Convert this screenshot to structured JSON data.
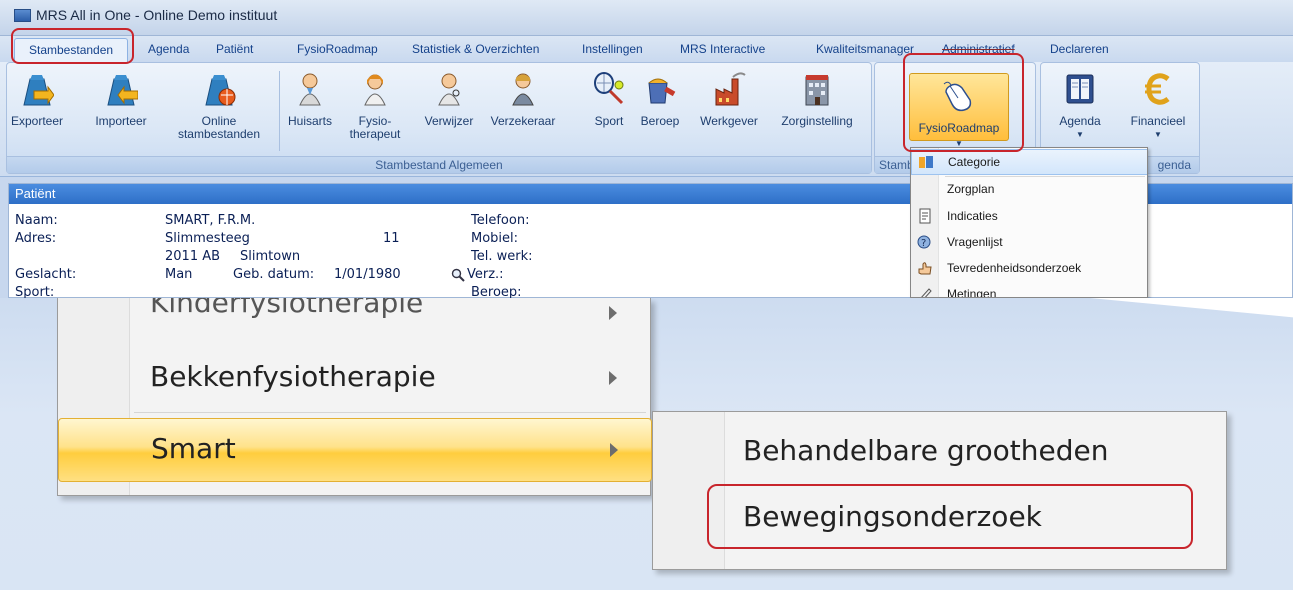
{
  "window": {
    "title": "MRS All in One - Online Demo instituut"
  },
  "tabs": [
    "Stambestanden",
    "Agenda",
    "Patiënt",
    "FysioRoadmap",
    "Statistiek & Overzichten",
    "Instellingen",
    "MRS Interactive",
    "Kwaliteitsmanager",
    "Administratief",
    "Declareren"
  ],
  "ribbon": {
    "buttons": [
      {
        "label": "Exporteer",
        "icon": "bag-arrow-export-icon"
      },
      {
        "label": "Importeer",
        "icon": "bag-arrow-import-icon"
      },
      {
        "label": "Online\nstambestanden",
        "icon": "bag-globe-icon"
      },
      {
        "label": "Huisarts",
        "icon": "doctor-person-icon"
      },
      {
        "label": "Fysio-\ntherapeut",
        "icon": "therapist-person-icon"
      },
      {
        "label": "Verwijzer",
        "icon": "referrer-person-icon"
      },
      {
        "label": "Verzekeraar",
        "icon": "insurer-person-icon"
      },
      {
        "label": "Sport",
        "icon": "racket-ball-icon"
      },
      {
        "label": "Beroep",
        "icon": "paint-bucket-icon"
      },
      {
        "label": "Werkgever",
        "icon": "factory-icon"
      },
      {
        "label": "Zorginstelling",
        "icon": "building-icon"
      }
    ],
    "group_label": "Stambestand Algemeen",
    "group2_label_partial": "Stamb",
    "fysio_button": "FysioRoadmap",
    "agenda_button": "Agenda",
    "financieel_button": "Financieel",
    "group3_label_partial": "genda"
  },
  "patient": {
    "header": "Patiënt",
    "labels": {
      "name": "Naam:",
      "address": "Adres:",
      "gender": "Geslacht:",
      "sport": "Sport:",
      "phone": "Telefoon:",
      "mobile": "Mobiel:",
      "work_phone": "Tel. werk:",
      "insurance": "Verz.:",
      "profession": "Beroep:",
      "birth": "Geb. datum:"
    },
    "values": {
      "name": "SMART, F.R.M.",
      "street": "Slimmesteeg",
      "house_number": "11",
      "zip": "2011 AB",
      "city": "Slimtown",
      "gender": "Man",
      "birth": "1/01/1980"
    }
  },
  "fysio_menu": [
    {
      "label": "Categorie",
      "icon": "category-icon"
    },
    {
      "label": "Zorgplan",
      "icon": ""
    },
    {
      "label": "Indicaties",
      "icon": "indications-icon"
    },
    {
      "label": "Vragenlijst",
      "icon": "questionnaire-icon"
    },
    {
      "label": "Tevredenheidsonderzoek",
      "icon": "satisfaction-icon"
    },
    {
      "label": "Metingen",
      "icon": "measurements-icon"
    }
  ],
  "zoom_menu": {
    "items": [
      "Kinderfysiotherapie",
      "Bekkenfysiotherapie",
      "Smart"
    ],
    "submenu": [
      "Behandelbare grootheden",
      "Bewegingsonderzoek"
    ]
  },
  "colors": {
    "highlight": "#c8252c",
    "ribbon": "#cddcf0",
    "selected": "#ffd24a"
  }
}
